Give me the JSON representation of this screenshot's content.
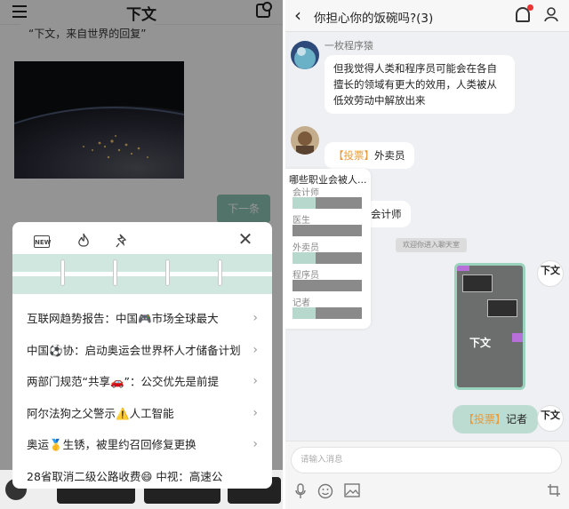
{
  "left": {
    "title": "下文",
    "quote": "“下文，来自世界的回复”",
    "next_label": "下一条",
    "sheet": {
      "new_badge": "NEW",
      "news": [
        "互联网趋势报告：中国🎮市场全球最大",
        "中国⚽协：启动奥运会世界杯人才储备计划",
        "两部门规范“共享🚗”：公交优先是前提",
        "阿尔法狗之父警示⚠️人工智能",
        "奥运🥇生锈，被里约召回修复更换",
        "28省取消二级公路收费😄 中视：高速公"
      ]
    }
  },
  "right": {
    "title": "你担心你的饭碗吗?(3)",
    "messages": [
      {
        "sender": "一枚程序猿",
        "text": "但我觉得人类和程序员可能会在各自擅长的领域有更大的效用，人类被从低效劳动中解放出来"
      },
      {
        "tag": "【投票】",
        "text": "外卖员"
      },
      {
        "text_tail": "会计师"
      }
    ],
    "poll": {
      "title": "哪些职业会被人...",
      "options": [
        {
          "label": "会计师",
          "share": 0.33
        },
        {
          "label": "医生",
          "share": 0
        },
        {
          "label": "外卖员",
          "share": 0.33
        },
        {
          "label": "程序员",
          "share": 0
        },
        {
          "label": "记者",
          "share": 0.33
        }
      ]
    },
    "system_notice": "欢迎你进入聊天室",
    "card": {
      "title": "下文"
    },
    "my_vote": {
      "tag": "【投票】",
      "text": "记者"
    },
    "my_avatar": "下文",
    "input_placeholder": "请输入消息"
  },
  "colors": {
    "accent_green": "#8ec7b6",
    "vote_orange": "#e89b3a",
    "notify_red": "#e33333"
  }
}
